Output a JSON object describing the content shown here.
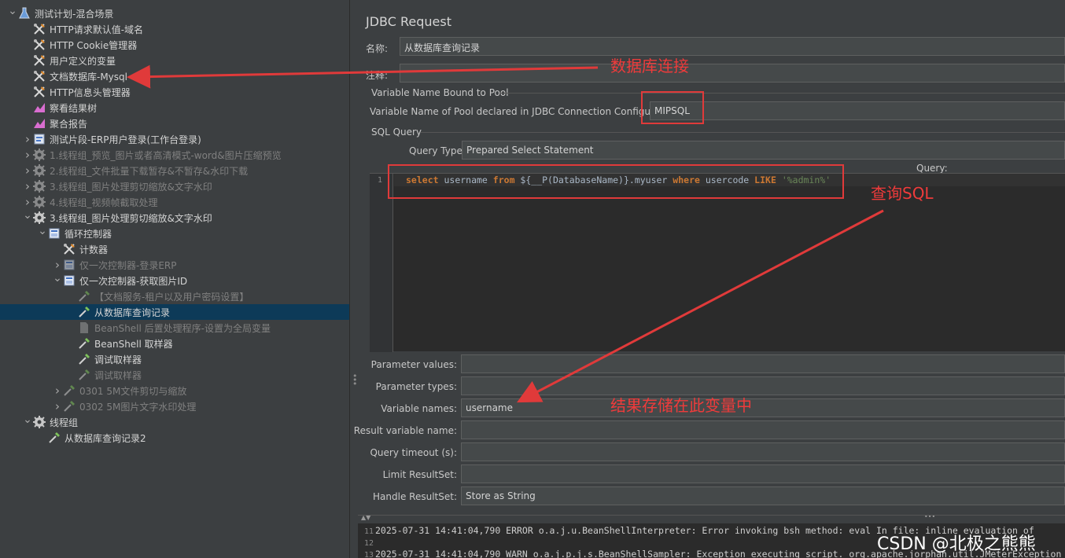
{
  "tree": {
    "items": [
      {
        "label": "测试计划-混合场景",
        "depth": 0,
        "arrow": "down",
        "icon": "flask-icon",
        "disabled": false
      },
      {
        "label": "HTTP请求默认值-域名",
        "depth": 1,
        "arrow": "",
        "icon": "wrench-icon",
        "disabled": false
      },
      {
        "label": "HTTP Cookie管理器",
        "depth": 1,
        "arrow": "",
        "icon": "wrench-icon",
        "disabled": false
      },
      {
        "label": "用户定义的变量",
        "depth": 1,
        "arrow": "",
        "icon": "wrench-icon",
        "disabled": false
      },
      {
        "label": "文档数据库-Mysql",
        "depth": 1,
        "arrow": "",
        "icon": "wrench-icon",
        "disabled": false
      },
      {
        "label": "HTTP信息头管理器",
        "depth": 1,
        "arrow": "",
        "icon": "wrench-icon",
        "disabled": false
      },
      {
        "label": "察看结果树",
        "depth": 1,
        "arrow": "",
        "icon": "chart-icon",
        "disabled": false
      },
      {
        "label": "聚合报告",
        "depth": 1,
        "arrow": "",
        "icon": "chart-icon",
        "disabled": false
      },
      {
        "label": "测试片段-ERP用户登录(工作台登录)",
        "depth": 1,
        "arrow": "right",
        "icon": "fragment-icon",
        "disabled": false
      },
      {
        "label": "1.线程组_预览_图片或者高清模式-word&图片压缩预览",
        "depth": 1,
        "arrow": "right",
        "icon": "gear-icon",
        "disabled": true
      },
      {
        "label": "2.线程组_文件批量下载暂存&不暂存&水印下载",
        "depth": 1,
        "arrow": "right",
        "icon": "gear-icon",
        "disabled": true
      },
      {
        "label": "3.线程组_图片处理剪切缩放&文字水印",
        "depth": 1,
        "arrow": "right",
        "icon": "gear-icon",
        "disabled": true
      },
      {
        "label": "4.线程组_视频帧截取处理",
        "depth": 1,
        "arrow": "right",
        "icon": "gear-icon",
        "disabled": true
      },
      {
        "label": "3.线程组_图片处理剪切缩放&文字水印",
        "depth": 1,
        "arrow": "down",
        "icon": "gear-icon",
        "disabled": false
      },
      {
        "label": "循环控制器",
        "depth": 2,
        "arrow": "down",
        "icon": "controller-icon",
        "disabled": false
      },
      {
        "label": "计数器",
        "depth": 3,
        "arrow": "",
        "icon": "wrench-icon",
        "disabled": false
      },
      {
        "label": "仅一次控制器-登录ERP",
        "depth": 3,
        "arrow": "right",
        "icon": "controller-icon",
        "disabled": true
      },
      {
        "label": "仅一次控制器-获取图片ID",
        "depth": 3,
        "arrow": "down",
        "icon": "controller-icon",
        "disabled": false
      },
      {
        "label": "【文档服务-租户以及用户密码设置】",
        "depth": 4,
        "arrow": "",
        "icon": "pipette-icon",
        "disabled": true
      },
      {
        "label": "从数据库查询记录",
        "depth": 4,
        "arrow": "",
        "icon": "pipette-icon",
        "disabled": false,
        "selected": true
      },
      {
        "label": "BeanShell 后置处理程序-设置为全局变量",
        "depth": 4,
        "arrow": "",
        "icon": "script-icon",
        "disabled": true
      },
      {
        "label": "BeanShell 取样器",
        "depth": 4,
        "arrow": "",
        "icon": "pipette-icon",
        "disabled": false
      },
      {
        "label": "调试取样器",
        "depth": 4,
        "arrow": "",
        "icon": "pipette-icon",
        "disabled": false
      },
      {
        "label": "调试取样器",
        "depth": 4,
        "arrow": "",
        "icon": "pipette-icon",
        "disabled": true
      },
      {
        "label": "0301 5M文件剪切与缩放",
        "depth": 3,
        "arrow": "right",
        "icon": "pipette-icon",
        "disabled": true
      },
      {
        "label": "0302 5M图片文字水印处理",
        "depth": 3,
        "arrow": "right",
        "icon": "pipette-icon",
        "disabled": true
      },
      {
        "label": "线程组",
        "depth": 1,
        "arrow": "down",
        "icon": "gear-icon",
        "disabled": false
      },
      {
        "label": "从数据库查询记录2",
        "depth": 2,
        "arrow": "",
        "icon": "pipette-icon",
        "disabled": false
      }
    ]
  },
  "panel": {
    "title": "JDBC Request",
    "name_label": "名称:",
    "name_value": "从数据库查询记录",
    "comment_label": "注释:",
    "comment_value": "",
    "pool_section": "Variable Name Bound to Pool",
    "pool_label": "Variable Name of Pool declared in JDBC Connection Configuration:",
    "pool_value": "MIPSQL",
    "sql_section": "SQL Query",
    "query_type_label": "Query Type:",
    "query_type_value": "Prepared Select Statement",
    "query_label": "Query:",
    "line_number": "1",
    "sql": {
      "kw_select": "select",
      "t1": " username ",
      "kw_from": "from",
      "t2": " ${__P(DatabaseName)}.myuser ",
      "kw_where": "where",
      "t3": " usercode ",
      "kw_like": "LIKE",
      "t4": " ",
      "str": "'%admin%'"
    },
    "params": [
      {
        "label": "Parameter values:",
        "value": ""
      },
      {
        "label": "Parameter types:",
        "value": ""
      },
      {
        "label": "Variable names:",
        "value": "username"
      },
      {
        "label": "Result variable name:",
        "value": ""
      },
      {
        "label": "Query timeout (s):",
        "value": ""
      },
      {
        "label": "Limit ResultSet:",
        "value": ""
      },
      {
        "label": "Handle ResultSet:",
        "value": "Store as String"
      }
    ]
  },
  "log": {
    "lines": [
      {
        "no": "11",
        "text": "2025-07-31 14:41:04,790 ERROR o.a.j.u.BeanShellInterpreter: Error invoking bsh method: eval   In file: inline evaluation of"
      },
      {
        "no": "12",
        "text": ""
      },
      {
        "no": "13",
        "text": "2025-07-31 14:41:04,790 WARN o.a.j.p.j.s.BeanShellSampler: Exception executing script. org.apache.jorphan.util.JMeterException"
      }
    ]
  },
  "annotations": {
    "db_conn": "数据库连接",
    "query_sql": "查询SQL",
    "result_var": "结果存储在此变量中",
    "accent": "#e03a3a"
  },
  "watermark": "CSDN @北极之熊熊"
}
